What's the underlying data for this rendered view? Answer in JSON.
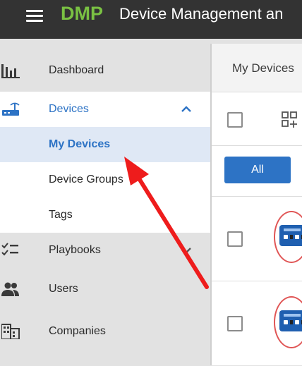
{
  "header": {
    "brand": "DMP",
    "title": "Device Management an"
  },
  "sidebar": {
    "items": [
      {
        "label": "Dashboard"
      },
      {
        "label": "Devices"
      },
      {
        "label": "My Devices"
      },
      {
        "label": "Device Groups"
      },
      {
        "label": "Tags"
      },
      {
        "label": "Playbooks"
      },
      {
        "label": "Users"
      },
      {
        "label": "Companies"
      }
    ]
  },
  "main": {
    "tab": "My Devices",
    "filter_button": "All"
  },
  "colors": {
    "brand_green": "#7ac143",
    "accent_blue": "#2d73c5",
    "annotation_red": "#ee1c1c"
  }
}
